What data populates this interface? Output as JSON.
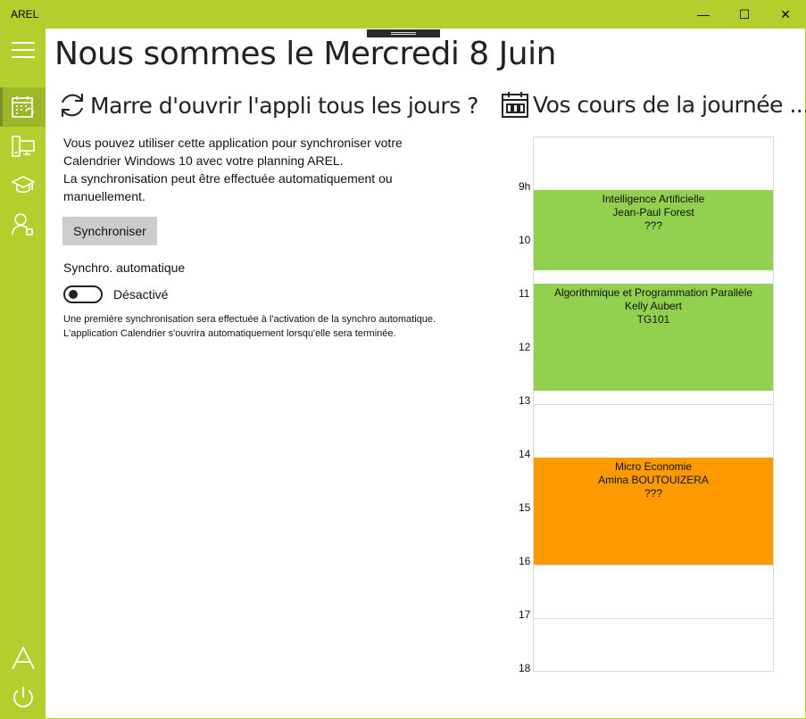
{
  "app": {
    "title": "AREL"
  },
  "window_controls": {
    "minimize": "—",
    "maximize": "☐",
    "close": "✕"
  },
  "header": {
    "title": "Nous sommes le Mercredi 8 Juin"
  },
  "sync_section": {
    "heading": "Marre d'ouvrir l'appli tous les jours ?",
    "description_lines": [
      "Vous pouvez utiliser cette application pour synchroniser votre",
      "Calendrier Windows 10 avec votre planning AREL.",
      "La synchronisation peut être effectuée automatiquement ou",
      "manuellement."
    ],
    "sync_button_label": "Synchroniser",
    "auto_label": "Synchro. automatique",
    "toggle_state": "Désactivé",
    "note_lines": [
      "Une première synchronisation sera effectuée à l'activation de la synchro automatique.",
      "L'application Calendrier s'ouvrira automatiquement lorsqu'elle sera terminée."
    ]
  },
  "schedule_section": {
    "heading": "Vos cours de la journée ...",
    "hours": [
      "9h",
      "10",
      "11",
      "12",
      "13",
      "14",
      "15",
      "16",
      "17",
      "18"
    ],
    "events": [
      {
        "start": 9,
        "end": 10.5,
        "color": "#92d050",
        "title": "Intelligence Artificielle",
        "teacher": "Jean-Paul Forest",
        "room": "???"
      },
      {
        "start": 10.75,
        "end": 12.75,
        "color": "#92d050",
        "title": "Algorithmique et Programmation Parallèle",
        "teacher": "Kelly Aubert",
        "room": "TG101"
      },
      {
        "start": 14,
        "end": 16,
        "color": "#ff9900",
        "title": "Micro Economie",
        "teacher": "Amina BOUTOUIZERA",
        "room": "???"
      }
    ]
  },
  "sidebar": {
    "items": [
      {
        "icon": "menu-icon"
      },
      {
        "icon": "calendar-sync-icon"
      },
      {
        "icon": "devices-icon"
      },
      {
        "icon": "graduation-cap-icon"
      },
      {
        "icon": "user-icon"
      },
      {
        "icon": "arel-logo-icon"
      },
      {
        "icon": "power-icon"
      }
    ]
  },
  "colors": {
    "accent": "#b2cf2e",
    "green_event": "#92d050",
    "orange_event": "#ff9900"
  }
}
